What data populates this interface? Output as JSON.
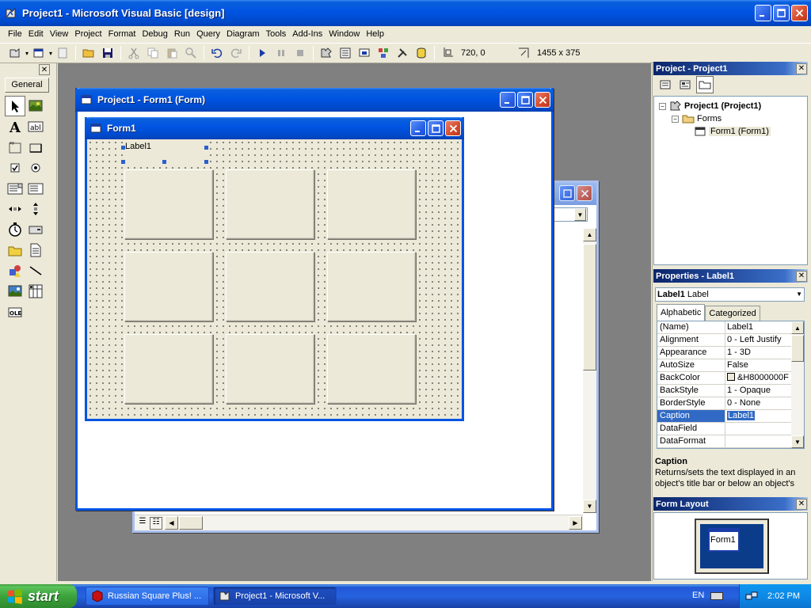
{
  "window": {
    "title": "Project1 - Microsoft Visual Basic [design]"
  },
  "menu": [
    "File",
    "Edit",
    "View",
    "Project",
    "Format",
    "Debug",
    "Run",
    "Query",
    "Diagram",
    "Tools",
    "Add-Ins",
    "Window",
    "Help"
  ],
  "toolbar": {
    "position_readout": "720, 0",
    "size_readout": "1455 x 375"
  },
  "toolbox": {
    "tab_label": "General",
    "tools": [
      "pointer-icon",
      "picturebox-icon",
      "label-icon",
      "textbox-icon",
      "frame-icon",
      "commandbutton-icon",
      "checkbox-icon",
      "optionbutton-icon",
      "combobox-icon",
      "listbox-icon",
      "hscrollbar-icon",
      "vscrollbar-icon",
      "timer-icon",
      "drivelistbox-icon",
      "dirlistbox-icon",
      "filelistbox-icon",
      "shape-icon",
      "line-icon",
      "image-icon",
      "data-icon",
      "ole-icon"
    ]
  },
  "designer": {
    "title": "Project1 - Form1 (Form)",
    "form_title": "Form1",
    "label_caption": "Label1"
  },
  "project_panel": {
    "title": "Project - Project1",
    "tree": {
      "root": "Project1 (Project1)",
      "folder": "Forms",
      "item": "Form1 (Form1)"
    }
  },
  "properties_panel": {
    "title": "Properties - Label1",
    "object_name": "Label1",
    "object_type": "Label",
    "tabs": [
      "Alphabetic",
      "Categorized"
    ],
    "rows": [
      {
        "name": "(Name)",
        "value": "Label1"
      },
      {
        "name": "Alignment",
        "value": "0 - Left Justify"
      },
      {
        "name": "Appearance",
        "value": "1 - 3D"
      },
      {
        "name": "AutoSize",
        "value": "False"
      },
      {
        "name": "BackColor",
        "value": "&H8000000F"
      },
      {
        "name": "BackStyle",
        "value": "1 - Opaque"
      },
      {
        "name": "BorderStyle",
        "value": "0 - None"
      },
      {
        "name": "Caption",
        "value": "Label1"
      },
      {
        "name": "DataField",
        "value": ""
      },
      {
        "name": "DataFormat",
        "value": ""
      }
    ],
    "desc_title": "Caption",
    "desc_text": "Returns/sets the text displayed in an object's title bar or below an object's"
  },
  "form_layout_panel": {
    "title": "Form Layout",
    "preview_label": "Form1"
  },
  "taskbar": {
    "start_label": "start",
    "items": [
      "Russian Square Plus! ...",
      "Project1 - Microsoft V..."
    ],
    "lang": "EN",
    "clock": "2:02 PM"
  },
  "colors": {
    "xp_blue": "#0054e3",
    "workspace": "#808080",
    "selection": "#316ac5"
  }
}
